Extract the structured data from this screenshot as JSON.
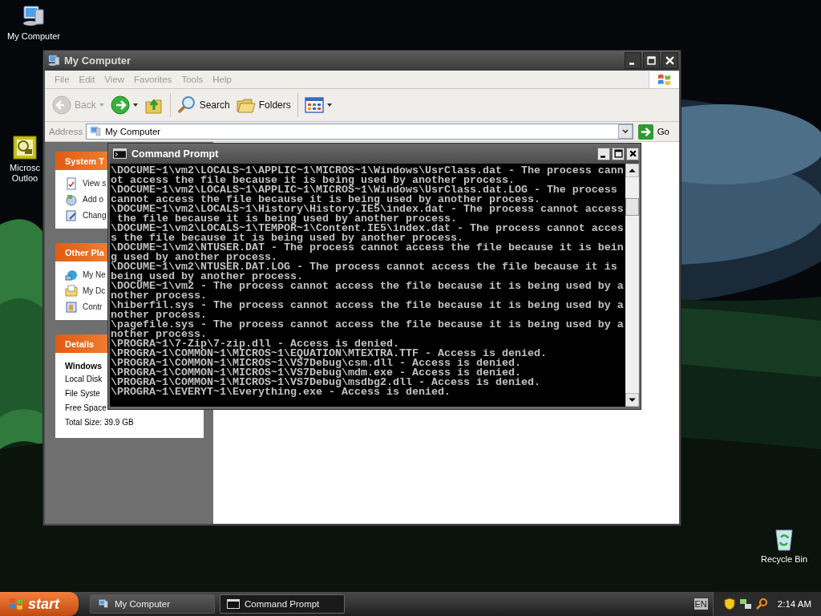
{
  "desktop_icons": [
    {
      "kind": "computer",
      "lines": [
        "My Computer"
      ]
    },
    {
      "kind": "mail",
      "lines": [
        "Microsc",
        "Outloo"
      ]
    },
    {
      "kind": "recycle",
      "lines": [
        "Recycle Bin"
      ]
    }
  ],
  "explorer": {
    "title": "My Computer",
    "menu": [
      "File",
      "Edit",
      "View",
      "Favorites",
      "Tools",
      "Help"
    ],
    "toolbar": [
      {
        "kind": "back",
        "label": "Back",
        "disabled": true
      },
      {
        "kind": "forward",
        "disabled": false
      },
      {
        "kind": "up",
        "disabled": false
      },
      {
        "kind": "search",
        "label": "Search",
        "disabled": false
      },
      {
        "kind": "folders",
        "label": "Folders",
        "disabled": false
      },
      {
        "kind": "views",
        "disabled": false
      }
    ],
    "address": {
      "label": "Address",
      "value": "My Computer",
      "go": "Go"
    },
    "task_panes": [
      {
        "title": "System T",
        "items": [
          {
            "kind": "info",
            "label": "View s"
          },
          {
            "kind": "programs",
            "label": "Add o"
          },
          {
            "kind": "settings",
            "label": "Chang"
          }
        ]
      },
      {
        "title": "Other Pla",
        "items": [
          {
            "kind": "network",
            "label": "My Ne"
          },
          {
            "kind": "documents",
            "label": "My Dc"
          },
          {
            "kind": "panel",
            "label": "Contr"
          }
        ]
      }
    ],
    "details": {
      "title": "Details",
      "heading": "Windows",
      "lines": [
        "Local Disk",
        "File Syste",
        "Free Space",
        "Total Size: 39.9 GB"
      ]
    }
  },
  "console": {
    "title": "Command Prompt",
    "lines": [
      "\\DOCUME~1\\vm2\\LOCALS~1\\APPLIC~1\\MICROS~1\\Windows\\UsrClass.dat - The process cann",
      "ot access the file because it is being used by another process.",
      "\\DOCUME~1\\vm2\\LOCALS~1\\APPLIC~1\\MICROS~1\\Windows\\UsrClass.dat.LOG - The process",
      "cannot access the file because it is being used by another process.",
      "\\DOCUME~1\\vm2\\LOCALS~1\\History\\History.IE5\\index.dat - The process cannot access",
      " the file because it is being used by another process.",
      "\\DOCUME~1\\vm2\\LOCALS~1\\TEMPOR~1\\Content.IE5\\index.dat - The process cannot acces",
      "s the file because it is being used by another process.",
      "\\DOCUME~1\\vm2\\NTUSER.DAT - The process cannot access the file because it is bein",
      "g used by another process.",
      "\\DOCUME~1\\vm2\\NTUSER.DAT.LOG - The process cannot access the file because it is",
      "being used by another process.",
      "\\DOCUME~1\\vm2 - The process cannot access the file because it is being used by a",
      "nother process.",
      "\\hiberfil.sys - The process cannot access the file because it is being used by a",
      "nother process.",
      "\\pagefile.sys - The process cannot access the file because it is being used by a",
      "nother process.",
      "\\PROGRA~1\\7-Zip\\7-zip.dll - Access is denied.",
      "\\PROGRA~1\\COMMON~1\\MICROS~1\\EQUATION\\MTEXTRA.TTF - Access is denied.",
      "\\PROGRA~1\\COMMON~1\\MICROS~1\\VS7Debug\\csm.dll - Access is denied.",
      "\\PROGRA~1\\COMMON~1\\MICROS~1\\VS7Debug\\mdm.exe - Access is denied.",
      "\\PROGRA~1\\COMMON~1\\MICROS~1\\VS7Debug\\msdbg2.dll - Access is denied.",
      "\\PROGRA~1\\EVERYT~1\\Everything.exe - Access is denied."
    ]
  },
  "taskbar": {
    "start": "start",
    "tasks": [
      {
        "kind": "computer",
        "label": "My Computer",
        "selected": false
      },
      {
        "kind": "console",
        "label": "Command Prompt",
        "selected": true
      }
    ],
    "language": "EN",
    "clock": "2:14 AM"
  }
}
